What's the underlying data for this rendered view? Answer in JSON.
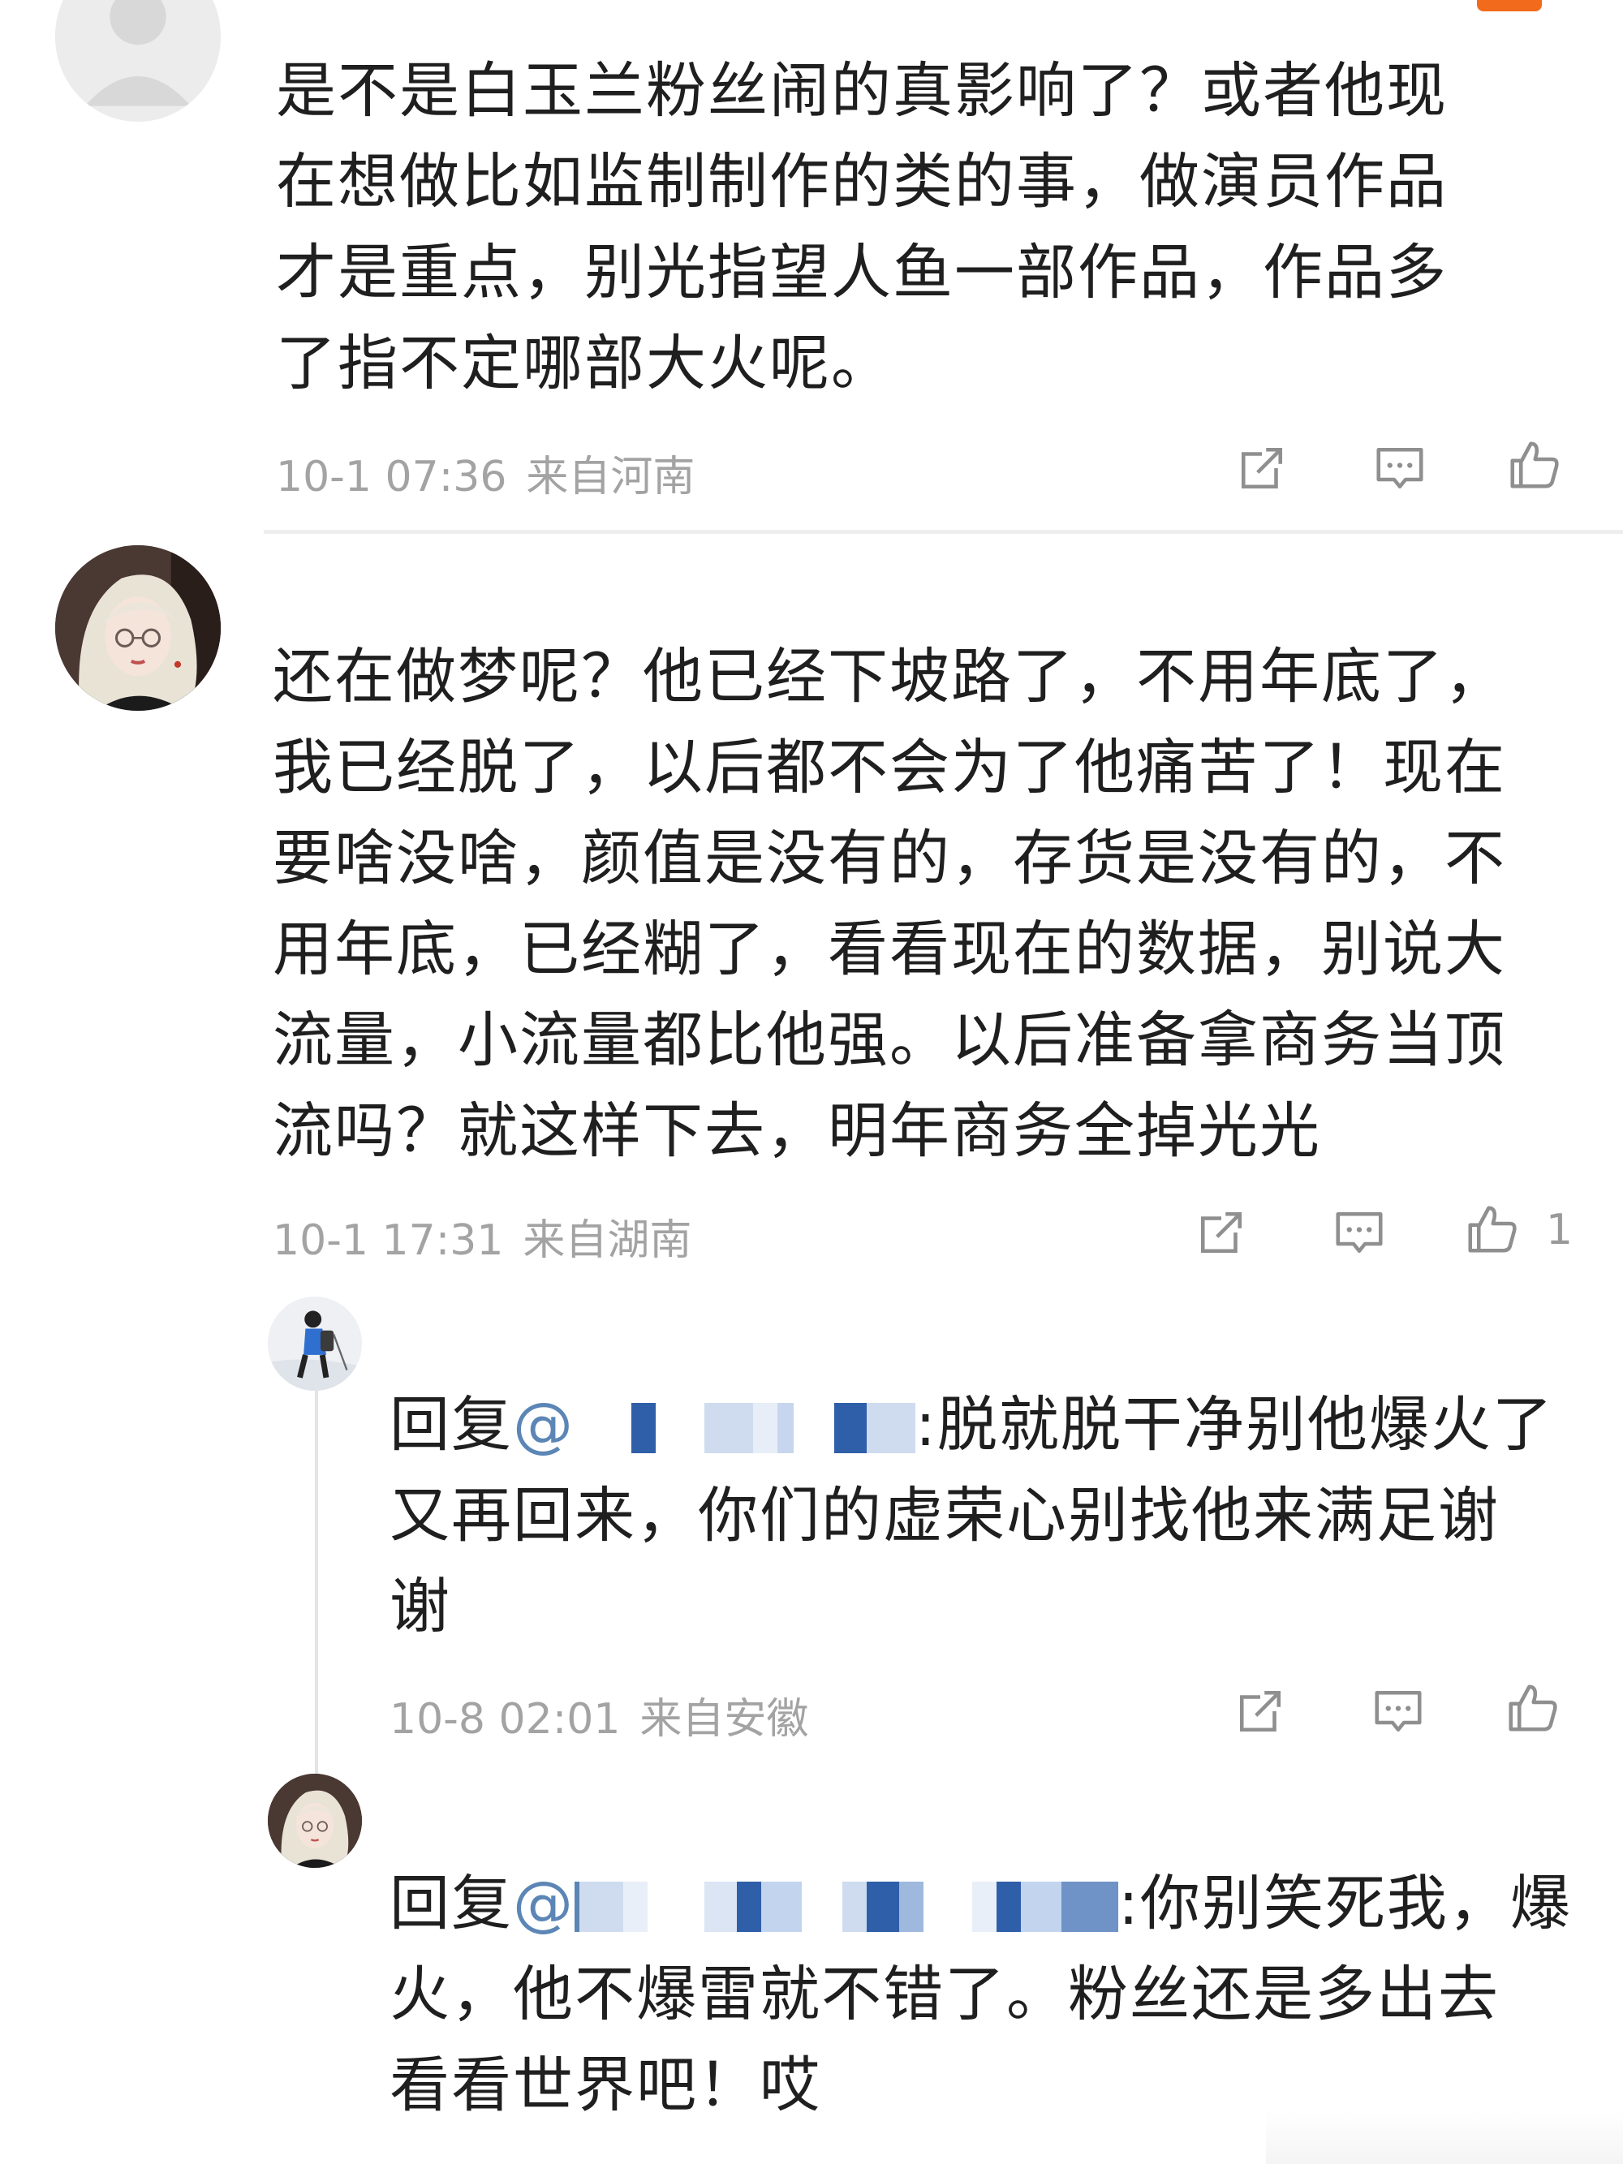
{
  "comments": [
    {
      "lines": [
        "是不是白玉兰粉丝闹的真影响了？或者他现",
        "在想做比如监制制作的类的事，做演员作品",
        "才是重点，别光指望人鱼一部作品，作品多",
        "了指不定哪部大火呢。"
      ],
      "time": "10-1 07:36",
      "location": "来自河南",
      "like_count": ""
    },
    {
      "lines": [
        "还在做梦呢？他已经下坡路了，不用年底了，",
        "我已经脱了，以后都不会为了他痛苦了！现在",
        "要啥没啥，颜值是没有的，存货是没有的，不",
        "用年底，已经糊了，看看现在的数据，别说大",
        "流量，小流量都比他强。以后准备拿商务当顶",
        "流吗？就这样下去，明年商务全掉光光"
      ],
      "time": "10-1 17:31",
      "location": "来自湖南",
      "like_count": "1"
    }
  ],
  "replies": [
    {
      "prefix": "回复",
      "at": "@",
      "line1_tail": ":脱就脱干净别他爆火了",
      "lines": [
        "又再回来，你们的虚荣心别找他来满足谢",
        "谢"
      ],
      "time": "10-8 02:01",
      "location": "来自安徽"
    },
    {
      "prefix": "回复",
      "at": "@",
      "line1_tail": ":你别笑死我，爆",
      "lines": [
        "火，他不爆雷就不错了。粉丝还是多出去",
        "看看世界吧！哎"
      ]
    }
  ],
  "icons": {
    "share": "share-icon",
    "comment": "comment-icon",
    "like": "thumbs-up-icon"
  },
  "colors": {
    "text": "#1f1f1f",
    "meta": "#a3a3a3",
    "mention": "#5b86b5",
    "accent": "#f26a1b"
  }
}
